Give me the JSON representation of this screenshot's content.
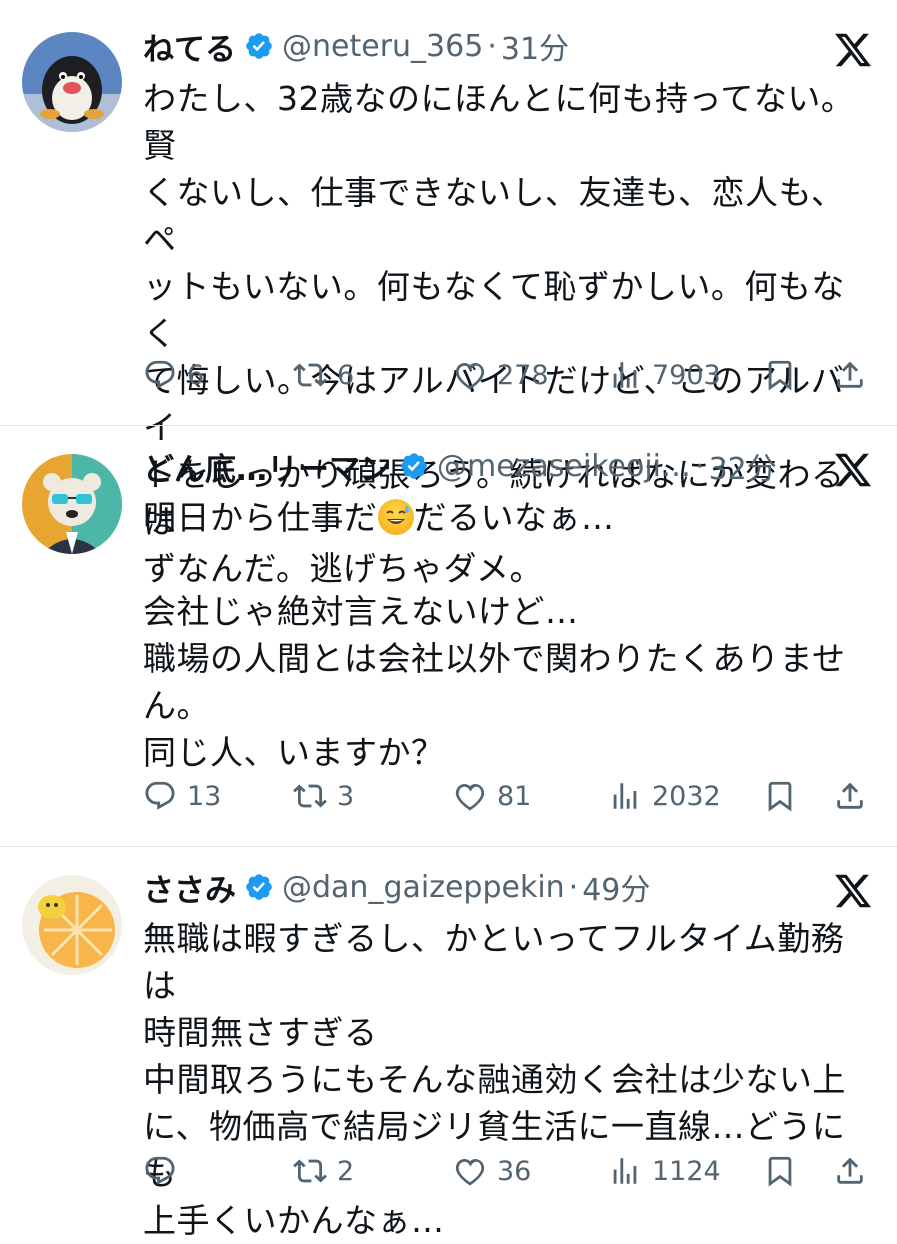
{
  "tweets": [
    {
      "name": "ねてる",
      "handle": "@neteru_365",
      "dot": "·",
      "time": "31分",
      "text": "わたし、32歳なのにほんとに何も持ってない。賢\nくないし、仕事できないし、友達も、恋人も、ペ\nットもいない。何もなくて恥ずかしい。何もなく\nて悔しい。今はアルバイトだけど、このアルバイ\nトをしっかり頑張ろう。続ければなにか変わるは\nずなんだ。逃げちゃダメ。",
      "replies": "6",
      "reposts": "6",
      "likes": "278",
      "views": "7903"
    },
    {
      "name": "どん底…リーマン",
      "handle": "@mezaseikeoji…",
      "dot": "·",
      "time": "32分",
      "text_before_emoji": "明日から仕事だ",
      "emoji": "sweat-smile-emoji",
      "text_after_emoji": "だるいなぁ…",
      "text": "\n\n会社じゃ絶対言えないけど…\n職場の人間とは会社以外で関わりたくありませ\nん。\n同じ人、いますか？",
      "replies": "13",
      "reposts": "3",
      "likes": "81",
      "views": "2032"
    },
    {
      "name": "ささみ",
      "handle": "@dan_gaizeppekin",
      "dot": "·",
      "time": "49分",
      "text": "無職は暇すぎるし、かといってフルタイム勤務は\n時間無さすぎる\n中間取ろうにもそんな融通効く会社は少ない上\nに、物価高で結局ジリ貧生活に一直線…どうにも\n上手くいかんなぁ…",
      "replies": "",
      "reposts": "2",
      "likes": "36",
      "views": "1124"
    }
  ],
  "colors": {
    "text": "#0f1419",
    "secondary": "#536471",
    "verified": "#1d9bf0",
    "divider": "#e1e6ea"
  },
  "icons": [
    "reply-icon",
    "repost-icon",
    "like-icon",
    "views-icon",
    "bookmark-icon",
    "share-icon",
    "x-logo-icon",
    "verified-badge-icon"
  ]
}
